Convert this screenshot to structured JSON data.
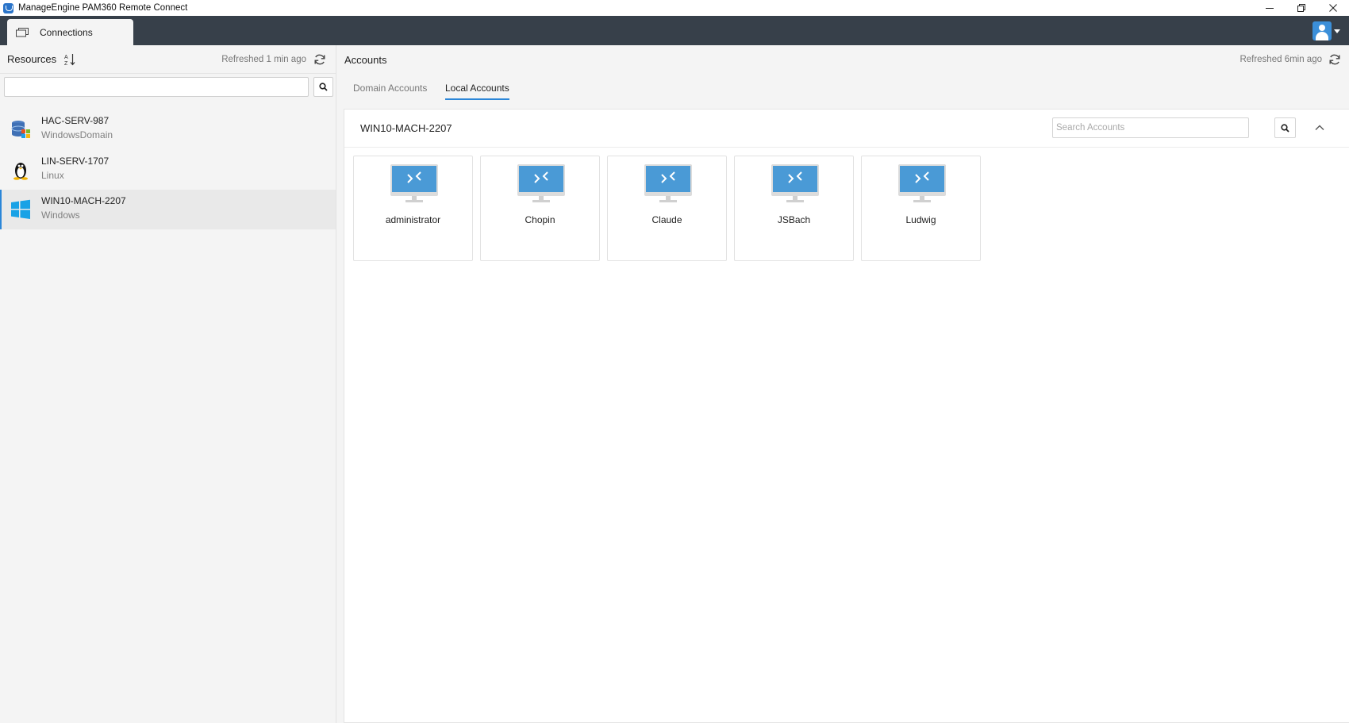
{
  "window": {
    "title": "ManageEngine PAM360 Remote Connect",
    "controls": [
      "minimize",
      "restore",
      "close"
    ]
  },
  "tabbar": {
    "tabs": [
      {
        "label": "Connections",
        "icon": "connections-icon"
      }
    ],
    "user_icon": "user-avatar-icon"
  },
  "resources": {
    "title": "Resources",
    "refreshed": "Refreshed 1 min ago",
    "search_value": "",
    "items": [
      {
        "name": "HAC-SERV-987",
        "type": "WindowsDomain",
        "icon": "windows-domain-icon",
        "selected": false
      },
      {
        "name": "LIN-SERV-1707",
        "type": "Linux",
        "icon": "linux-icon",
        "selected": false
      },
      {
        "name": "WIN10-MACH-2207",
        "type": "Windows",
        "icon": "windows-icon",
        "selected": true
      }
    ]
  },
  "accounts": {
    "title": "Accounts",
    "refreshed": "Refreshed 6min ago",
    "tabs": [
      {
        "label": "Domain Accounts",
        "active": false
      },
      {
        "label": "Local Accounts",
        "active": true
      }
    ],
    "machine": "WIN10-MACH-2207",
    "search_placeholder": "Search Accounts",
    "cards": [
      {
        "name": "administrator"
      },
      {
        "name": "Chopin"
      },
      {
        "name": "Claude"
      },
      {
        "name": "JSBach"
      },
      {
        "name": "Ludwig"
      }
    ]
  },
  "colors": {
    "accent": "#2b86d8",
    "tabbar_bg": "#37404a",
    "monitor_screen": "#4a9ad6",
    "panel_bg": "#f4f4f4"
  }
}
